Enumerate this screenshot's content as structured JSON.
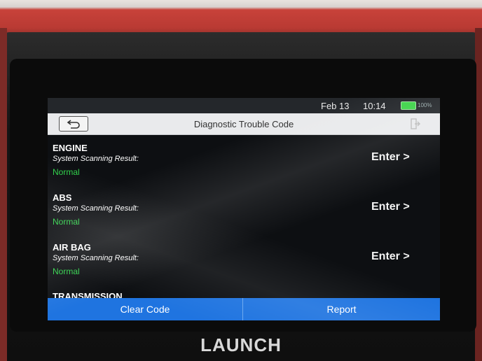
{
  "status_bar": {
    "date": "Feb 13",
    "time": "10:14",
    "battery_label": "100%"
  },
  "header": {
    "title": "Diagnostic Trouble Code"
  },
  "systems": [
    {
      "name": "ENGINE",
      "result_label": "System Scanning Result:",
      "status": "Normal",
      "action": "Enter >"
    },
    {
      "name": "ABS",
      "result_label": "System Scanning Result:",
      "status": "Normal",
      "action": "Enter >"
    },
    {
      "name": "AIR BAG",
      "result_label": "System Scanning Result:",
      "status": "Normal",
      "action": "Enter >"
    }
  ],
  "partial_item": {
    "name": "TRANSMISSION"
  },
  "footer": {
    "clear_label": "Clear Code",
    "report_label": "Report"
  },
  "device": {
    "brand": "LAUNCH"
  },
  "colors": {
    "accent": "#1f74e0",
    "status_ok": "#2fd14a",
    "bumper": "#c8423a"
  }
}
